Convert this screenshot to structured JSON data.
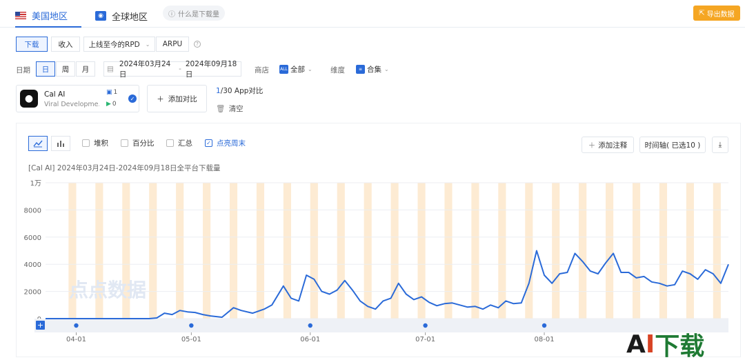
{
  "tabs": [
    {
      "label": "美国地区",
      "active": true
    },
    {
      "label": "全球地区",
      "active": false
    }
  ],
  "help_label": "什么是下载量",
  "export_label": "导出数据",
  "metrics": [
    "下载",
    "收入",
    "上线至今的RPD",
    "ARPU"
  ],
  "date": {
    "label": "日期",
    "granularity": [
      "日",
      "周",
      "月"
    ],
    "start": "2024年03月24日",
    "separator": "-",
    "end": "2024年09月18日"
  },
  "store": {
    "label": "商店",
    "badge": "ALL",
    "value": "全部"
  },
  "dimension": {
    "label": "维度",
    "value": "合集"
  },
  "app": {
    "name": "Cal AI",
    "developer": "Viral Developme...",
    "ios_count": "1",
    "android_count": "0"
  },
  "add_compare": "添加对比",
  "compare_count": {
    "current": "1",
    "rest": "/30 App对比"
  },
  "clear_label": "清空",
  "chart_options": [
    "堆积",
    "百分比",
    "汇总",
    "点亮周末"
  ],
  "add_note": "添加注释",
  "timeline": "时间轴( 已选10 )",
  "chart_title": "[Cal AI]  2024年03月24日-2024年09月18日全平台下载量",
  "watermark": "点点数据",
  "corner_logo": {
    "a": "A",
    "i": "I",
    "cn": "下载"
  },
  "accent_color": "#2a6ad8",
  "weekend_color": "#fdebd3",
  "chart_data": {
    "type": "line",
    "title": "[Cal AI]  2024年03月24日-2024年09月18日全平台下载量",
    "x_start": "2024-03-24",
    "x_end": "2024-09-18",
    "x_ticks": [
      "04-01",
      "05-01",
      "06-01",
      "07-01",
      "08-01"
    ],
    "y_ticks": [
      "0",
      "2000",
      "4000",
      "6000",
      "8000",
      "1万"
    ],
    "ylim": [
      0,
      10000
    ],
    "weekend_highlight": true,
    "series": [
      {
        "color": "#2a6ad8",
        "points": [
          [
            "2024-03-24",
            0
          ],
          [
            "2024-04-01",
            0
          ],
          [
            "2024-04-10",
            0
          ],
          [
            "2024-04-20",
            0
          ],
          [
            "2024-04-22",
            50
          ],
          [
            "2024-04-24",
            400
          ],
          [
            "2024-04-26",
            300
          ],
          [
            "2024-04-28",
            600
          ],
          [
            "2024-04-30",
            500
          ],
          [
            "2024-05-02",
            450
          ],
          [
            "2024-05-04",
            300
          ],
          [
            "2024-05-06",
            200
          ],
          [
            "2024-05-09",
            100
          ],
          [
            "2024-05-12",
            800
          ],
          [
            "2024-05-14",
            600
          ],
          [
            "2024-05-17",
            400
          ],
          [
            "2024-05-20",
            700
          ],
          [
            "2024-05-22",
            1000
          ],
          [
            "2024-05-25",
            2400
          ],
          [
            "2024-05-27",
            1500
          ],
          [
            "2024-05-29",
            1300
          ],
          [
            "2024-05-31",
            3200
          ],
          [
            "2024-06-02",
            2900
          ],
          [
            "2024-06-04",
            2000
          ],
          [
            "2024-06-06",
            1800
          ],
          [
            "2024-06-08",
            2100
          ],
          [
            "2024-06-10",
            2800
          ],
          [
            "2024-06-12",
            2100
          ],
          [
            "2024-06-14",
            1300
          ],
          [
            "2024-06-16",
            900
          ],
          [
            "2024-06-18",
            700
          ],
          [
            "2024-06-20",
            1300
          ],
          [
            "2024-06-22",
            1500
          ],
          [
            "2024-06-24",
            2600
          ],
          [
            "2024-06-26",
            1800
          ],
          [
            "2024-06-28",
            1400
          ],
          [
            "2024-06-30",
            1600
          ],
          [
            "2024-07-02",
            1200
          ],
          [
            "2024-07-04",
            950
          ],
          [
            "2024-07-06",
            1100
          ],
          [
            "2024-07-08",
            1150
          ],
          [
            "2024-07-10",
            1000
          ],
          [
            "2024-07-12",
            850
          ],
          [
            "2024-07-14",
            900
          ],
          [
            "2024-07-16",
            700
          ],
          [
            "2024-07-18",
            1000
          ],
          [
            "2024-07-20",
            800
          ],
          [
            "2024-07-22",
            1300
          ],
          [
            "2024-07-24",
            1100
          ],
          [
            "2024-07-26",
            1150
          ],
          [
            "2024-07-28",
            2600
          ],
          [
            "2024-07-30",
            5000
          ],
          [
            "2024-08-01",
            3200
          ],
          [
            "2024-08-03",
            2600
          ],
          [
            "2024-08-05",
            3300
          ],
          [
            "2024-08-07",
            3400
          ],
          [
            "2024-08-09",
            4800
          ],
          [
            "2024-08-11",
            4200
          ],
          [
            "2024-08-13",
            3500
          ],
          [
            "2024-08-15",
            3300
          ],
          [
            "2024-08-17",
            4100
          ],
          [
            "2024-08-19",
            4800
          ],
          [
            "2024-08-21",
            3400
          ],
          [
            "2024-08-23",
            3400
          ],
          [
            "2024-08-25",
            3000
          ],
          [
            "2024-08-27",
            3100
          ],
          [
            "2024-08-29",
            2700
          ],
          [
            "2024-08-31",
            2600
          ],
          [
            "2024-09-02",
            2400
          ],
          [
            "2024-09-04",
            2500
          ],
          [
            "2024-09-06",
            3500
          ],
          [
            "2024-09-08",
            3300
          ],
          [
            "2024-09-10",
            2900
          ],
          [
            "2024-09-12",
            3600
          ],
          [
            "2024-09-14",
            3300
          ],
          [
            "2024-09-16",
            2600
          ],
          [
            "2024-09-18",
            4000
          ]
        ]
      }
    ]
  }
}
